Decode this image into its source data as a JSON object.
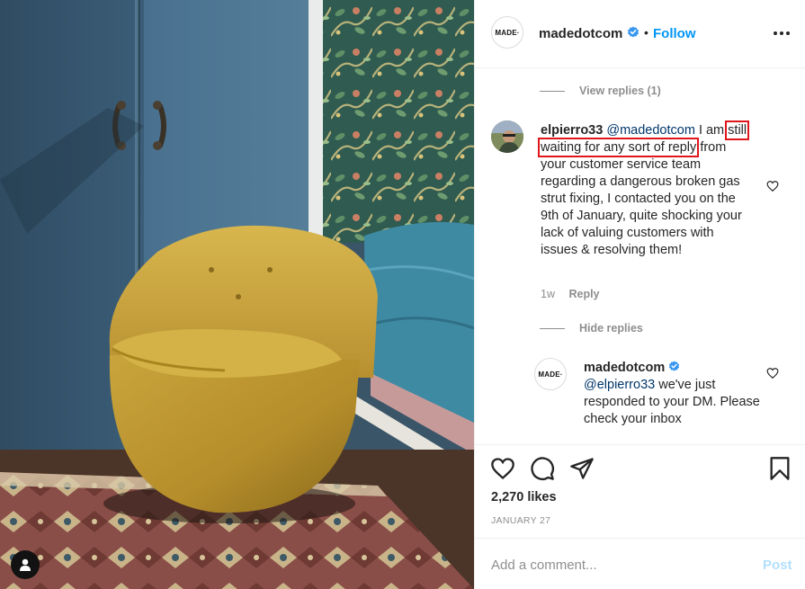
{
  "post": {
    "author": "madedotcom",
    "avatar_text": "MADE·",
    "separator": "•",
    "follow_label": "Follow",
    "likes": "2,270 likes",
    "date": "JANUARY 27"
  },
  "comments": {
    "view_replies": "View replies (1)",
    "comment": {
      "username": "elpierro33",
      "mention": "@madedotcom",
      "text_first": "I am",
      "text_highlight": "still waiting for any sort of reply",
      "text_rest": "from your customer service team regarding a dangerous broken gas strut fixing, I contacted you on the 9th of January, quite shocking your lack of valuing customers with issues & resolving them!",
      "time": "1w",
      "reply_label": "Reply"
    },
    "hide_replies": "Hide replies",
    "reply": {
      "username": "madedotcom",
      "mention": "@elpierro33",
      "text": "we've just responded to your DM. Please check your inbox"
    }
  },
  "add_comment": {
    "placeholder": "Add a comment...",
    "post_label": "Post"
  },
  "colors": {
    "accent": "#0095f6",
    "highlight": "#e0161c",
    "mention": "#00376b",
    "muted": "#8e8e8e"
  },
  "icons": [
    "user-tag-icon",
    "verified-badge-icon",
    "more-options-icon",
    "heart-icon",
    "comment-icon",
    "share-icon",
    "bookmark-icon"
  ]
}
